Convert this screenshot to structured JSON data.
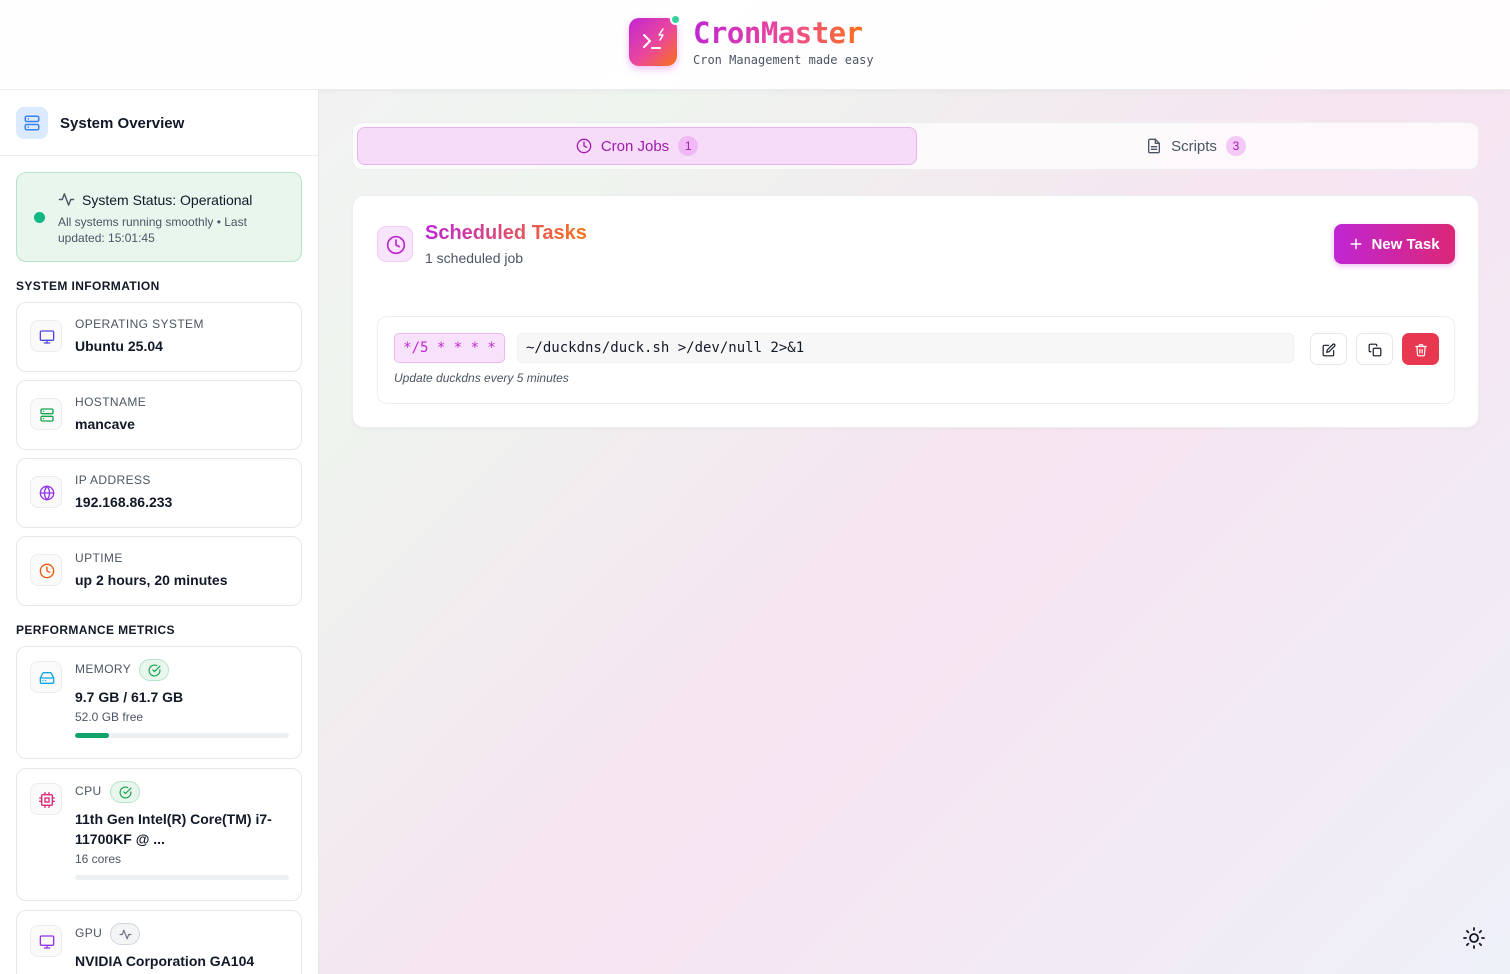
{
  "header": {
    "app_title": "CronMaster",
    "app_subtitle": "Cron Management made easy"
  },
  "sidebar": {
    "title": "System Overview",
    "status": {
      "title": "System Status: Operational",
      "subtitle": "All systems running smoothly • Last updated: 15:01:45",
      "color": "#10b981"
    },
    "system_info_label": "SYSTEM INFORMATION",
    "system_info": [
      {
        "label": "OPERATING SYSTEM",
        "value": "Ubuntu 25.04",
        "icon": "monitor-icon",
        "color": "#4f46e5"
      },
      {
        "label": "HOSTNAME",
        "value": "mancave",
        "icon": "server-icon",
        "color": "#16a34a"
      },
      {
        "label": "IP ADDRESS",
        "value": "192.168.86.233",
        "icon": "globe-icon",
        "color": "#9333ea"
      },
      {
        "label": "UPTIME",
        "value": "up 2 hours, 20 minutes",
        "icon": "clock-icon",
        "color": "#ea580c"
      }
    ],
    "performance_label": "PERFORMANCE METRICS",
    "metrics": [
      {
        "label": "MEMORY",
        "value": "9.7 GB / 61.7 GB",
        "sub": "52.0 GB free",
        "usage": 0.157,
        "status": "ok",
        "icon": "hard-drive-icon"
      },
      {
        "label": "CPU",
        "value": "11th Gen Intel(R) Core(TM) i7-11700KF @ ...",
        "sub": "16 cores",
        "usage": 0.0,
        "status": "ok",
        "icon": "cpu-icon"
      },
      {
        "label": "GPU",
        "value": "NVIDIA Corporation GA104",
        "status": "neutral",
        "icon": "monitor-icon"
      }
    ]
  },
  "tabs": [
    {
      "label": "Cron Jobs",
      "count": "1",
      "icon": "clock-icon",
      "active": true
    },
    {
      "label": "Scripts",
      "count": "3",
      "icon": "file-text-icon",
      "active": false
    }
  ],
  "panel": {
    "title": "Scheduled Tasks",
    "subtitle": "1 scheduled job",
    "new_task_label": "New Task",
    "jobs": [
      {
        "schedule": "*/5 * * * *",
        "command": "~/duckdns/duck.sh >/dev/null 2>&1",
        "description": "Update duckdns every 5 minutes"
      }
    ]
  },
  "colors": {
    "accent": "#c026d3",
    "accent_secondary": "#f97316",
    "danger": "#e8384f",
    "success": "#10b981"
  }
}
